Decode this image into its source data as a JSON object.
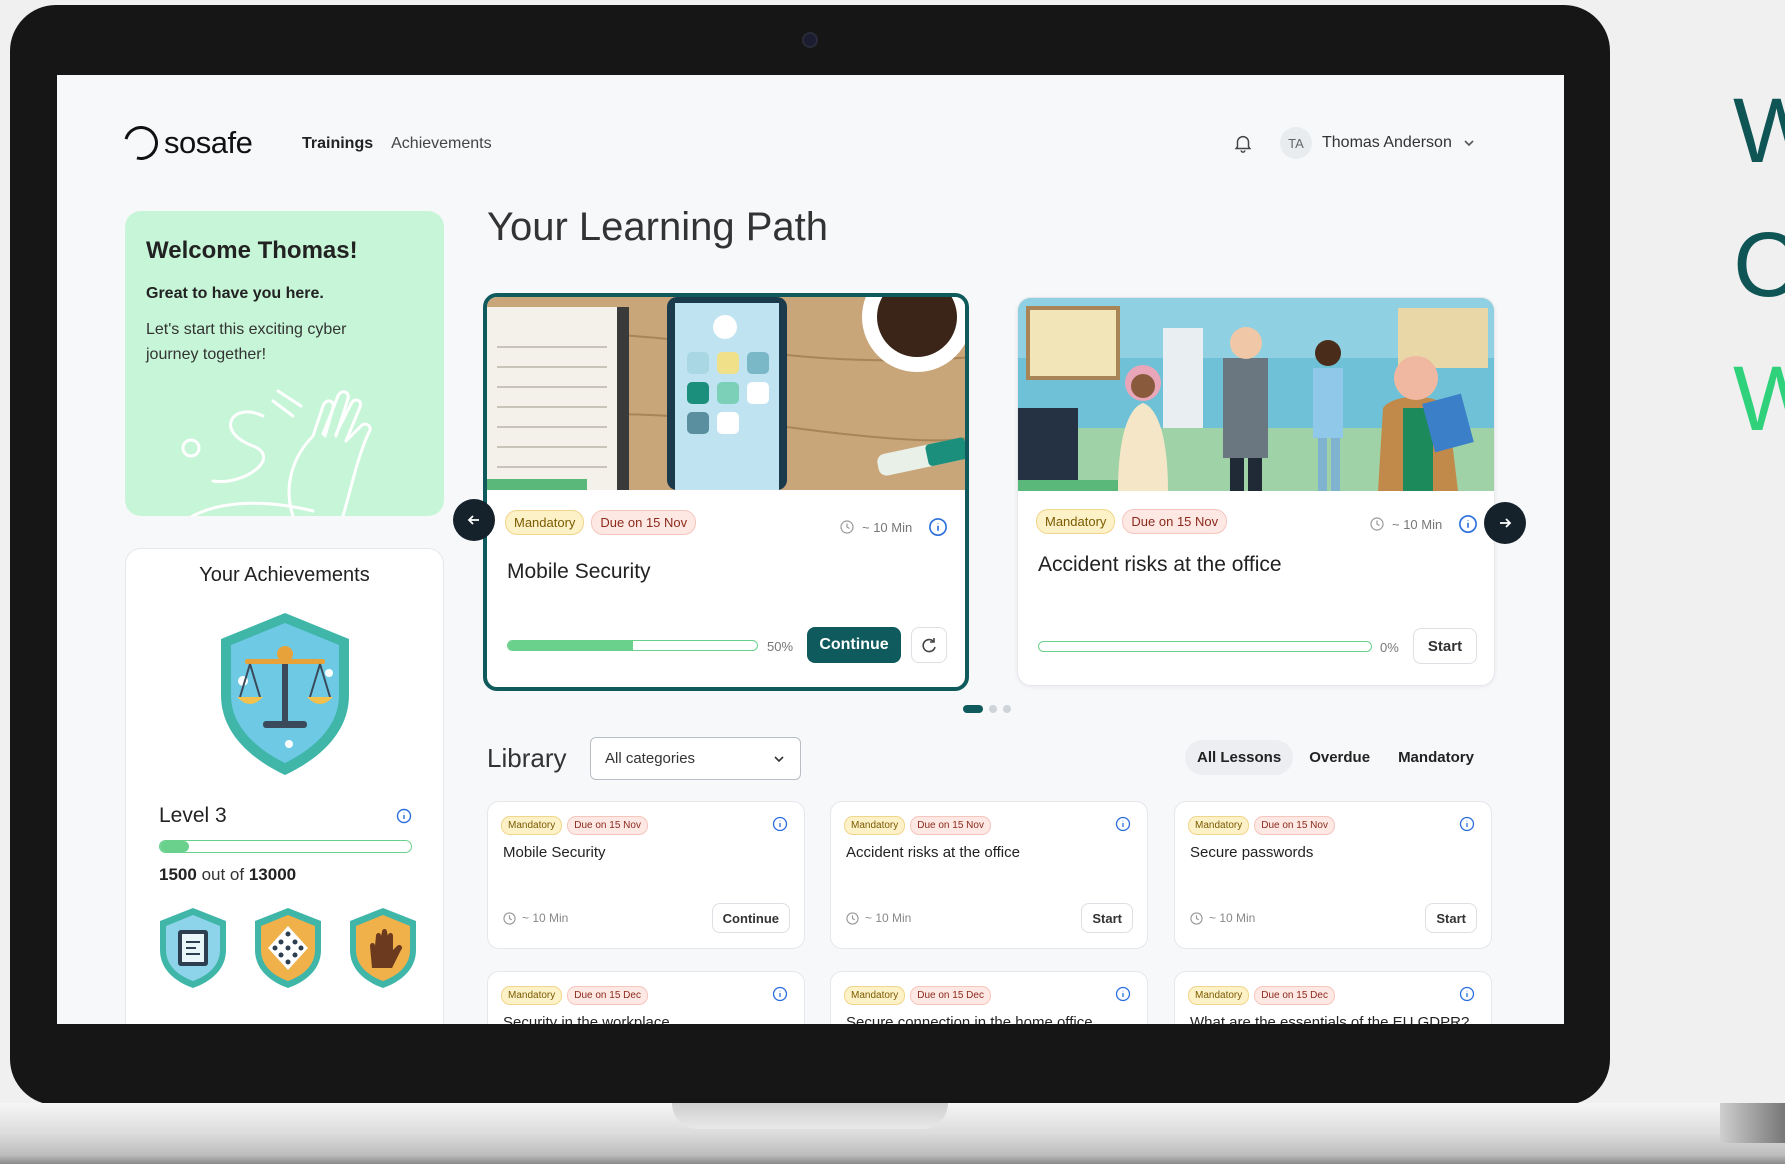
{
  "right_text": [
    "W",
    "C",
    "W"
  ],
  "header": {
    "logo_text": "sosafe",
    "nav": [
      {
        "label": "Trainings",
        "active": true
      },
      {
        "label": "Achievements",
        "active": false
      }
    ],
    "user": {
      "initials": "TA",
      "name": "Thomas Anderson"
    }
  },
  "welcome": {
    "title": "Welcome Thomas!",
    "subtitle": "Great to have you here.",
    "text": "Let's start this exciting cyber journey together!"
  },
  "achievements": {
    "title": "Your Achievements",
    "level_label": "Level 3",
    "points_current": "1500",
    "points_sep": "out of",
    "points_total": "13000",
    "progress_fraction": 0.115
  },
  "learning_path": {
    "title": "Your Learning Path",
    "cards": [
      {
        "tag_mandatory": "Mandatory",
        "tag_due": "Due on 15 Nov",
        "duration": "~ 10 Min",
        "name": "Mobile Security",
        "progress_label": "50%",
        "progress": 0.5,
        "button": "Continue"
      },
      {
        "tag_mandatory": "Mandatory",
        "tag_due": "Due on 15 Nov",
        "duration": "~ 10 Min",
        "name": "Accident risks at the office",
        "progress_label": "0%",
        "progress": 0,
        "button": "Start"
      }
    ]
  },
  "library": {
    "title": "Library",
    "category_select": "All categories",
    "filters": [
      "All Lessons",
      "Overdue",
      "Mandatory"
    ],
    "cards": [
      {
        "tag_mandatory": "Mandatory",
        "tag_due": "Due on 15 Nov",
        "name": "Mobile Security",
        "duration": "~ 10 Min",
        "button": "Continue"
      },
      {
        "tag_mandatory": "Mandatory",
        "tag_due": "Due on 15 Nov",
        "name": "Accident risks at the office",
        "duration": "~ 10 Min",
        "button": "Start"
      },
      {
        "tag_mandatory": "Mandatory",
        "tag_due": "Due on 15 Nov",
        "name": "Secure passwords",
        "duration": "~ 10 Min",
        "button": "Start"
      },
      {
        "tag_mandatory": "Mandatory",
        "tag_due": "Due on 15 Dec",
        "name": "Security in the workplace",
        "duration": "",
        "button": ""
      },
      {
        "tag_mandatory": "Mandatory",
        "tag_due": "Due on 15 Dec",
        "name": "Secure connection in the home office",
        "duration": "",
        "button": ""
      },
      {
        "tag_mandatory": "Mandatory",
        "tag_due": "Due on 15 Dec",
        "name": "What are the essentials of the EU GDPR?",
        "duration": "",
        "button": ""
      }
    ]
  },
  "colors": {
    "brand": "#0e5a5c",
    "progress": "#6ad18d",
    "welcome_bg": "#c7f5d7",
    "accent_green": "#2fd27a"
  }
}
